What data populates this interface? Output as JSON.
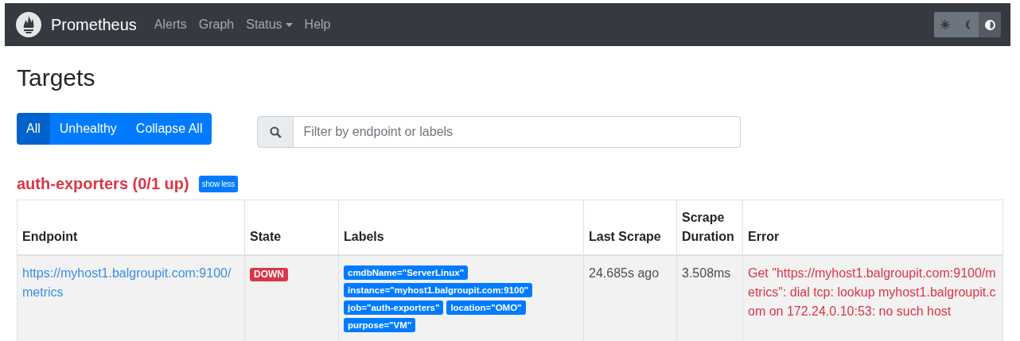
{
  "navbar": {
    "brand": "Prometheus",
    "links": [
      {
        "label": "Alerts",
        "kind": "link"
      },
      {
        "label": "Graph",
        "kind": "link"
      },
      {
        "label": "Status",
        "kind": "dropdown"
      },
      {
        "label": "Help",
        "kind": "link"
      }
    ],
    "theme_buttons": [
      {
        "kind": "light",
        "selected": false
      },
      {
        "kind": "dark",
        "selected": false
      },
      {
        "kind": "auto",
        "selected": true
      }
    ]
  },
  "page_title": "Targets",
  "filter_buttons": [
    {
      "label": "All",
      "selected": true
    },
    {
      "label": "Unhealthy",
      "selected": false
    },
    {
      "label": "Collapse All",
      "selected": false
    }
  ],
  "search": {
    "placeholder": "Filter by endpoint or labels"
  },
  "pool": {
    "title": "auth-exporters (0/1 up)",
    "healthy": false,
    "toggle": "show less",
    "table": {
      "columns": [
        "Endpoint",
        "State",
        "Labels",
        "Last Scrape",
        "Scrape Duration",
        "Error"
      ],
      "rows": [
        {
          "endpoint": "https://myhost1.balgroupit.com:9100/metrics",
          "state": "DOWN",
          "labels": [
            "cmdbName=\"ServerLinux\"",
            "instance=\"myhost1.balgroupit.com:9100\"",
            "job=\"auth-exporters\"",
            "location=\"OMO\"",
            "purpose=\"VM\""
          ],
          "last_scrape": "24.685s ago",
          "scrape_duration": "3.508ms",
          "error": "Get \"https://myhost1.balgroupit.com:9100/metrics\": dial tcp: lookup myhost1.balgroupit.com on 172.24.0.10:53: no such host"
        }
      ]
    }
  }
}
